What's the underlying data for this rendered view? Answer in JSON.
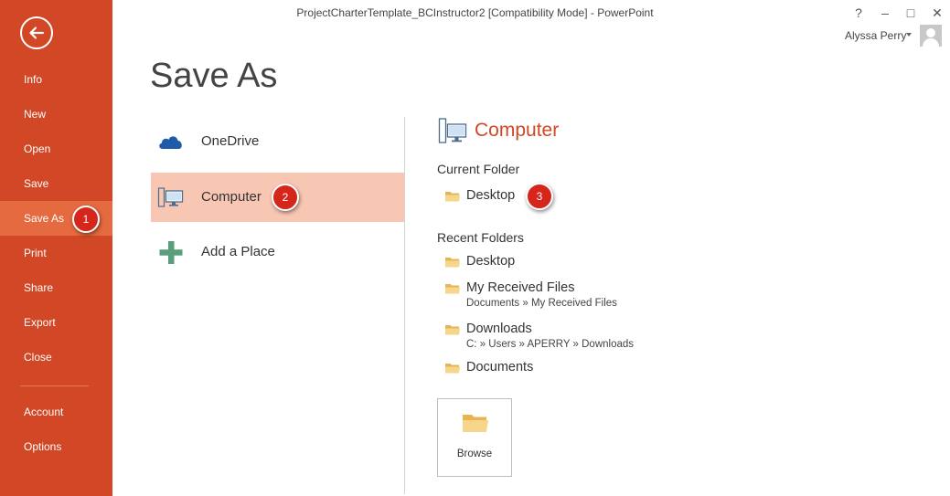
{
  "window": {
    "title": "ProjectCharterTemplate_BCInstructor2 [Compatibility Mode] - PowerPoint",
    "help": "?",
    "minimize": "–",
    "maximize": "□",
    "close": "✕",
    "user_name": "Alyssa Perry"
  },
  "nav": {
    "items": [
      {
        "label": "Info"
      },
      {
        "label": "New"
      },
      {
        "label": "Open"
      },
      {
        "label": "Save"
      },
      {
        "label": "Save As",
        "active": true
      },
      {
        "label": "Print"
      },
      {
        "label": "Share"
      },
      {
        "label": "Export"
      },
      {
        "label": "Close"
      },
      {
        "label": "Account"
      },
      {
        "label": "Options"
      }
    ]
  },
  "page": {
    "title": "Save As"
  },
  "places": [
    {
      "label": "OneDrive",
      "icon": "cloud-icon"
    },
    {
      "label": "Computer",
      "icon": "computer-icon",
      "selected": true
    },
    {
      "label": "Add a Place",
      "icon": "plus-icon"
    }
  ],
  "detail": {
    "title": "Computer",
    "current_folder_heading": "Current Folder",
    "current_folder": {
      "name": "Desktop"
    },
    "recent_folders_heading": "Recent Folders",
    "recent_folders": [
      {
        "name": "Desktop",
        "path": ""
      },
      {
        "name": "My Received Files",
        "path": "Documents » My Received Files"
      },
      {
        "name": "Downloads",
        "path": "C: » Users » APERRY » Downloads"
      },
      {
        "name": "Documents",
        "path": ""
      }
    ],
    "browse_label": "Browse"
  },
  "markers": [
    "1",
    "2",
    "3"
  ],
  "colors": {
    "accent": "#d24726",
    "nav_active": "#e56a3f",
    "selected_place": "#f8c7b3",
    "marker": "#d6261c",
    "folder": "#f2c26b"
  }
}
